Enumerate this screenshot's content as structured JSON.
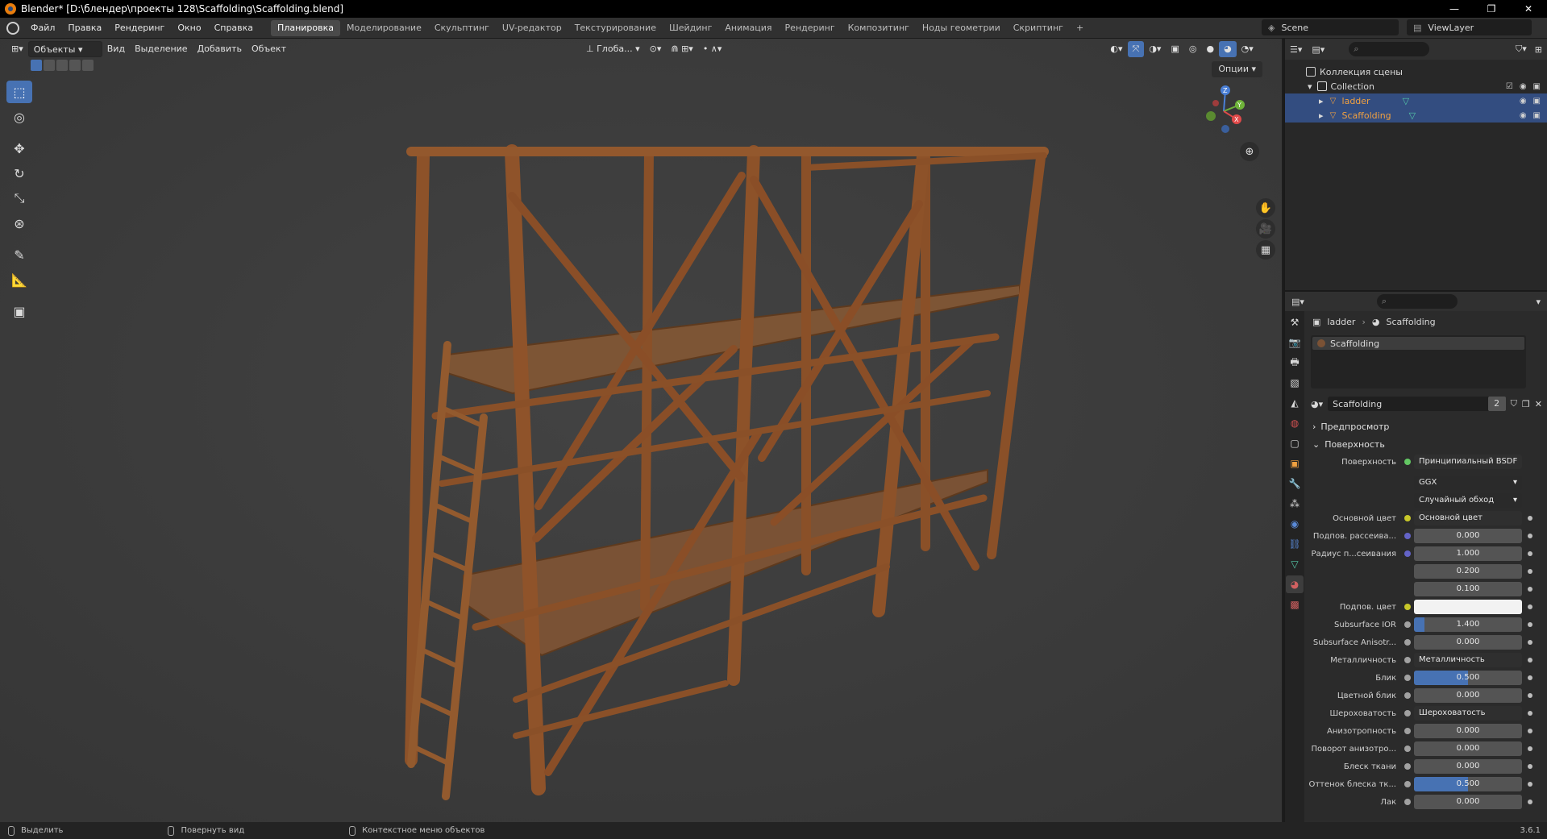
{
  "window": {
    "title": "Blender* [D:\\блендер\\проекты 128\\Scaffolding\\Scaffolding.blend]",
    "controls": [
      "—",
      "❐",
      "✕"
    ]
  },
  "menu": [
    "Файл",
    "Правка",
    "Рендеринг",
    "Окно",
    "Справка"
  ],
  "workspaces": [
    "Планировка",
    "Моделирование",
    "Скульптинг",
    "UV-редактор",
    "Текстурирование",
    "Шейдинг",
    "Анимация",
    "Рендеринг",
    "Композитинг",
    "Ноды геометрии",
    "Скриптинг"
  ],
  "workspace_add": "+",
  "scene": "Scene",
  "view_layer": "ViewLayer",
  "viewport": {
    "mode": "Объекты",
    "menus": [
      "Вид",
      "Выделение",
      "Добавить",
      "Объект"
    ],
    "orientation": "Глоба...",
    "options": "Опции",
    "gizmo_labels": {
      "z": "Z",
      "y": "Y",
      "x": "X"
    }
  },
  "outliner": {
    "rows": [
      {
        "label": "Коллекция сцены",
        "type": "scene-collection"
      },
      {
        "label": "Collection",
        "type": "collection"
      },
      {
        "label": "ladder",
        "type": "object",
        "selected": true
      },
      {
        "label": "Scaffolding",
        "type": "object",
        "selected": true
      }
    ]
  },
  "properties": {
    "breadcrumb": {
      "object": "ladder",
      "material": "Scaffolding"
    },
    "slot": "Scaffolding",
    "material_name": "Scaffolding",
    "material_users": "2",
    "panels": {
      "preview": "Предпросмотр",
      "surface": "Поверхность"
    },
    "surface_label": "Поверхность",
    "surface_shader": "Принципиальный BSDF",
    "distribution": "GGX",
    "subsurface_method": "Случайный обход",
    "rows": [
      {
        "label": "Основной цвет",
        "value": "Основной цвет",
        "socket": "y",
        "kind": "link",
        "expand": true
      },
      {
        "label": "Подпов. рассеива...",
        "value": "0.000",
        "socket": "b",
        "kind": "num"
      },
      {
        "label": "Радиус п...сеивания",
        "value": "1.000",
        "socket": "b",
        "kind": "num"
      },
      {
        "label": "",
        "value": "0.200",
        "socket": "",
        "kind": "num"
      },
      {
        "label": "",
        "value": "0.100",
        "socket": "",
        "kind": "num"
      },
      {
        "label": "Подпов. цвет",
        "value": "",
        "socket": "y",
        "kind": "color"
      },
      {
        "label": "Subsurface IOR",
        "value": "1.400",
        "socket": "gr",
        "kind": "num",
        "fill": 0.1
      },
      {
        "label": "Subsurface Anisotr...",
        "value": "0.000",
        "socket": "gr",
        "kind": "num"
      },
      {
        "label": "Металличность",
        "value": "Металличность",
        "socket": "gr",
        "kind": "link",
        "expand": true
      },
      {
        "label": "Блик",
        "value": "0.500",
        "socket": "gr",
        "kind": "num",
        "fill": 0.5
      },
      {
        "label": "Цветной блик",
        "value": "0.000",
        "socket": "gr",
        "kind": "num"
      },
      {
        "label": "Шероховатость",
        "value": "Шероховатость",
        "socket": "gr",
        "kind": "link",
        "expand": true
      },
      {
        "label": "Анизотропность",
        "value": "0.000",
        "socket": "gr",
        "kind": "num"
      },
      {
        "label": "Поворот анизотро...",
        "value": "0.000",
        "socket": "gr",
        "kind": "num"
      },
      {
        "label": "Блеск ткани",
        "value": "0.000",
        "socket": "gr",
        "kind": "num"
      },
      {
        "label": "Оттенок блеска тк...",
        "value": "0.500",
        "socket": "gr",
        "kind": "num",
        "fill": 0.5
      },
      {
        "label": "Лак",
        "value": "0.000",
        "socket": "gr",
        "kind": "num"
      }
    ]
  },
  "status": {
    "select": "Выделить",
    "rotate": "Повернуть вид",
    "context": "Контекстное меню объектов",
    "version": "3.6.1"
  },
  "colors": {
    "accent": "#4772b3",
    "selected_row": "#334d80",
    "wood": "#8a5028"
  }
}
